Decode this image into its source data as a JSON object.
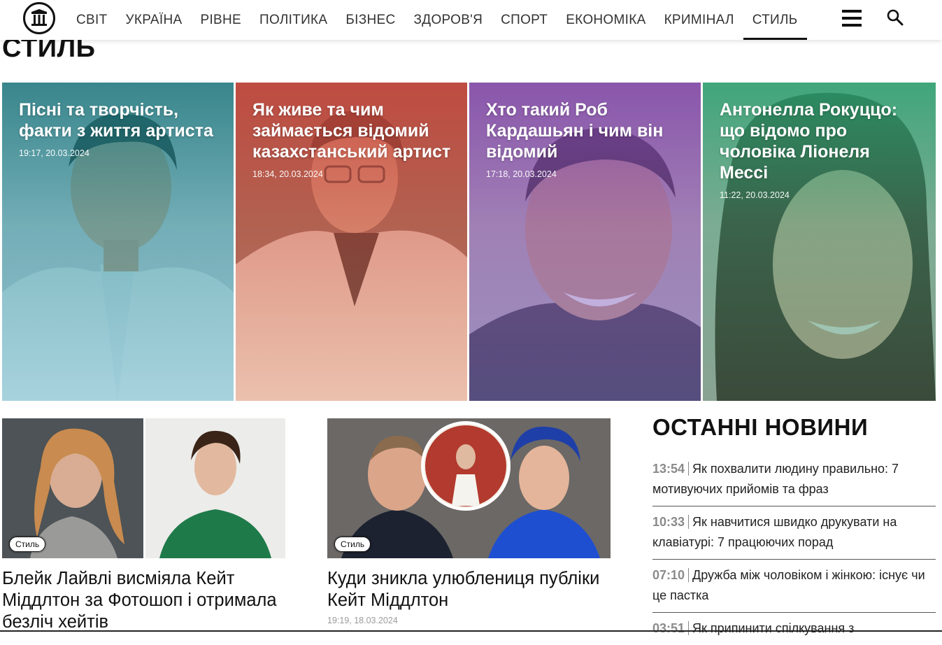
{
  "nav": {
    "items": [
      {
        "label": "СВІТ"
      },
      {
        "label": "УКРАЇНА"
      },
      {
        "label": "РІВНЕ"
      },
      {
        "label": "ПОЛІТИКА"
      },
      {
        "label": "БІЗНЕС"
      },
      {
        "label": "ЗДОРОВ'Я"
      },
      {
        "label": "СПОРТ"
      },
      {
        "label": "ЕКОНОМІКА"
      },
      {
        "label": "КРИМІНАЛ"
      },
      {
        "label": "СТИЛЬ"
      }
    ],
    "active": "СТИЛЬ",
    "icons": [
      "logo-icon",
      "menu-icon",
      "search-icon"
    ]
  },
  "page": {
    "title": "СТИЛЬ"
  },
  "hero": [
    {
      "title": "Пісні та творчість, факти з життя артиста",
      "date": "19:17, 20.03.2024",
      "tint": "#1e8f8a"
    },
    {
      "title": "Як живе та чим займається відомий казахстанський артист",
      "date": "18:34, 20.03.2024",
      "tint": "#d05a4c"
    },
    {
      "title": "Хто такий Роб Кардашьян і чим він відомий",
      "date": "17:18, 20.03.2024",
      "tint": "#8e4fb2"
    },
    {
      "title": "Антонелла Рокуццо: що відомо про чоловіка Лiонеля Мессі",
      "date": "11:22, 20.03.2024",
      "tint": "#2a9b78"
    }
  ],
  "articles": [
    {
      "badge": "Стиль",
      "title": "Блейк Лайвлі висміяла Кейт Міддлтон за Фотошоп і отримала безліч хейтів",
      "date": ""
    },
    {
      "badge": "Стиль",
      "title": "Куди зникла улюблениця публіки Кейт Міддлтон",
      "date": "19:19, 18.03.2024"
    }
  ],
  "latest": {
    "title": "ОСТАННІ НОВИНИ",
    "items": [
      {
        "time": "13:54",
        "text": "Як похвалити людину правильно: 7 мотивуючих прийомів та фраз"
      },
      {
        "time": "10:33",
        "text": "Як навчитися швидко друкувати на клавіатурі: 7 працюючих порад"
      },
      {
        "time": "07:10",
        "text": "Дружба між чоловіком і жінкою: існує чи це пастка"
      },
      {
        "time": "03:51",
        "text": "Як припинити спілкування з"
      }
    ]
  }
}
